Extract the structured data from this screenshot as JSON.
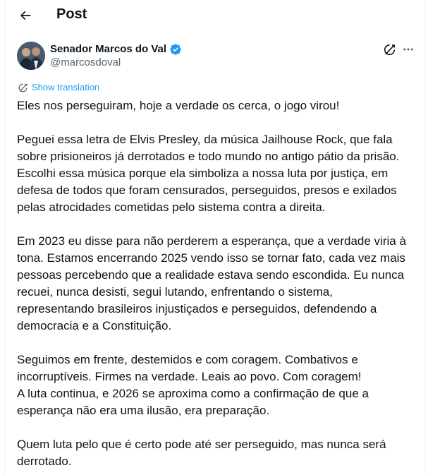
{
  "header": {
    "back_icon": "arrow-left-icon",
    "title": "Post"
  },
  "author": {
    "name": "Senador Marcos do Val",
    "handle": "@marcosdoval",
    "verified_icon": "verified-badge-icon",
    "verified_color": "#1d9bf0"
  },
  "actions": {
    "grok_icon": "grok-icon",
    "more_icon": "more-horizontal-icon"
  },
  "translate": {
    "icon": "translate-icon",
    "label": "Show translation",
    "color": "#1d9bf0"
  },
  "post": {
    "lines": [
      "Eles nos perseguiram, hoje a verdade os cerca, o jogo virou!",
      "",
      "Peguei essa letra de Elvis Presley, da música Jailhouse Rock, que fala",
      "sobre prisioneiros já derrotados e todo mundo no antigo pátio da prisão.",
      "Escolhi essa música porque ela simboliza a nossa luta por justiça, em",
      "defesa de todos que foram censurados, perseguidos, presos e exilados",
      "pelas atrocidades cometidas pelo sistema contra a direita.",
      "",
      "Em 2023 eu disse para não perderem a esperança, que a verdade viria à",
      "tona. Estamos encerrando 2025 vendo isso se tornar fato, cada vez mais",
      "pessoas percebendo que a realidade estava sendo escondida. Eu nunca",
      "recuei, nunca desisti, segui lutando, enfrentando o sistema,",
      "representando brasileiros injustiçados e perseguidos, defendendo a",
      "democracia e a Constituição.",
      "",
      "Seguimos em frente, destemidos e com coragem. Combativos e",
      "incorruptíveis. Firmes na verdade. Leais ao povo. Com coragem!",
      "A luta continua, e 2026 se aproxima como a confirmação de que a",
      "esperança não era uma ilusão, era preparação.",
      "",
      "Quem luta pelo que é certo pode até ser perseguido, mas nunca será",
      "derrotado."
    ]
  }
}
